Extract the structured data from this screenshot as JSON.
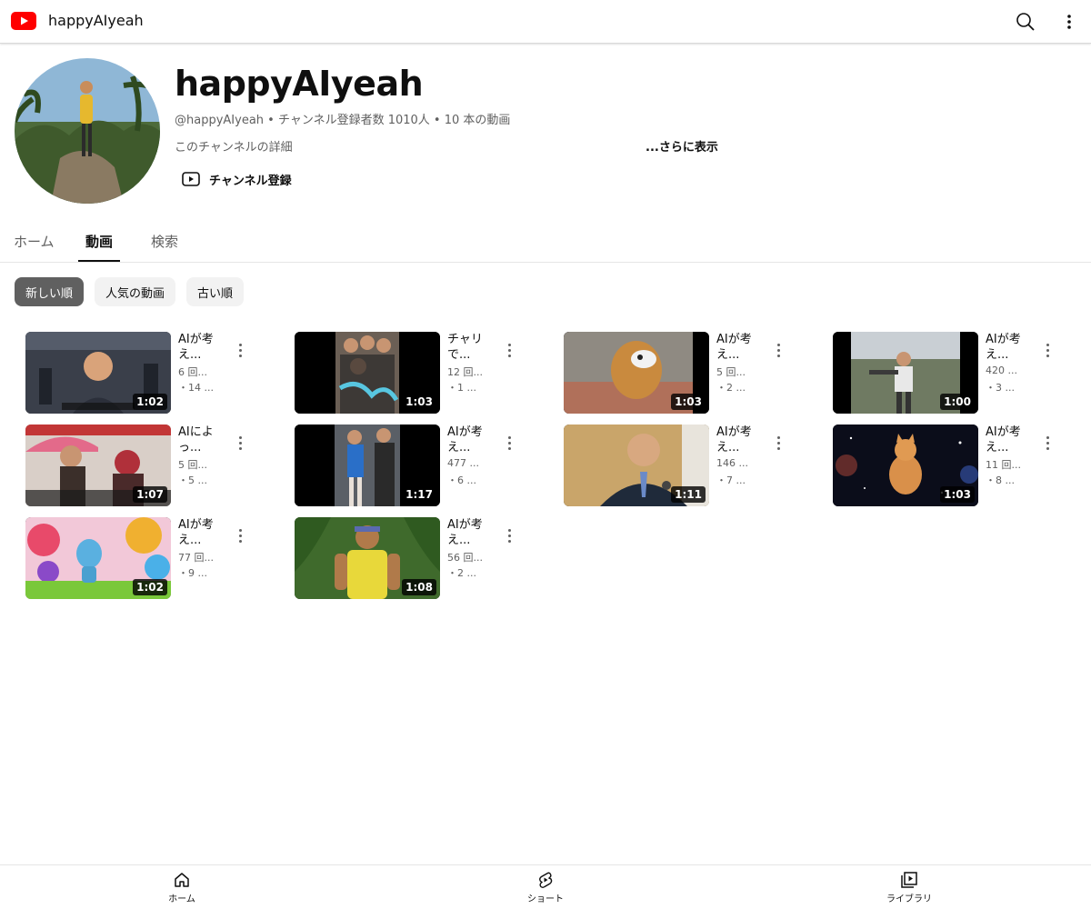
{
  "app": {
    "title": "happyAIyeah",
    "brand_color": "#ff0000"
  },
  "channel": {
    "name": "happyAIyeah",
    "meta": "@happyAIyeah • チャンネル登録者数 1010人 • 10 本の動画",
    "description": "このチャンネルの詳細",
    "show_more": "...さらに表示",
    "subscribe_label": "チャンネル登録"
  },
  "tabs": [
    {
      "label": "ホーム",
      "active": false
    },
    {
      "label": "動画",
      "active": true
    },
    {
      "label": "検索",
      "active": false
    }
  ],
  "chips": [
    {
      "label": "新しい順",
      "active": true
    },
    {
      "label": "人気の動画",
      "active": false
    },
    {
      "label": "古い順",
      "active": false
    }
  ],
  "videos": [
    {
      "title": "AIが考え...",
      "views": "6 回...",
      "age": "・14 ...",
      "duration": "1:02",
      "thumb": "street-interview"
    },
    {
      "title": "チャリで...",
      "views": "12 回...",
      "age": "・1 ...",
      "duration": "1:03",
      "thumb": "group-photo"
    },
    {
      "title": "AIが考え...",
      "views": "5 回...",
      "age": "・2 ...",
      "duration": "1:03",
      "thumb": "dog-monster"
    },
    {
      "title": "AIが考え...",
      "views": "420 ...",
      "age": "・3 ...",
      "duration": "1:00",
      "thumb": "gunman"
    },
    {
      "title": "AIによっ...",
      "views": "5 回...",
      "age": "・5 ...",
      "duration": "1:07",
      "thumb": "umbrella-news"
    },
    {
      "title": "AIが考え...",
      "views": "477 ...",
      "age": "・6 ...",
      "duration": "1:17",
      "thumb": "cosplay"
    },
    {
      "title": "AIが考え...",
      "views": "146 ...",
      "age": "・7 ...",
      "duration": "1:11",
      "thumb": "crying-man"
    },
    {
      "title": "AIが考え...",
      "views": "11 回...",
      "age": "・8 ...",
      "duration": "1:03",
      "thumb": "space-cat"
    },
    {
      "title": "AIが考え...",
      "views": "77 回...",
      "age": "・9 ...",
      "duration": "1:02",
      "thumb": "robot-balloons"
    },
    {
      "title": "AIが考え...",
      "views": "56 回...",
      "age": "・2 ...",
      "duration": "1:08",
      "thumb": "jungle-man"
    }
  ],
  "bottom_nav": [
    {
      "label": "ホーム",
      "icon": "home-icon"
    },
    {
      "label": "ショート",
      "icon": "shorts-icon"
    },
    {
      "label": "ライブラリ",
      "icon": "library-icon"
    }
  ]
}
